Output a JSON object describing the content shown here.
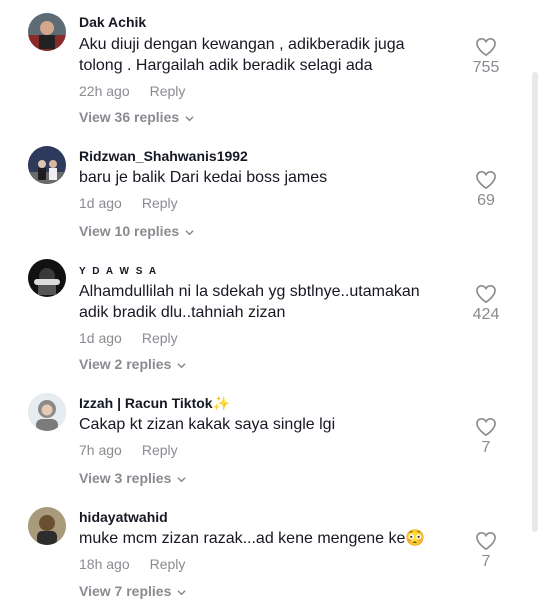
{
  "comments": [
    {
      "username": "Dak Achik",
      "text": "Aku diuji dengan kewangan , adikberadik juga tolong . Hargailah adik beradik selagi ada",
      "time": "22h ago",
      "reply_label": "Reply",
      "view_replies": "View 36 replies",
      "likes": "755",
      "avatar_color": "#7a2b2b"
    },
    {
      "username": "Ridzwan_Shahwanis1992",
      "text": "baru je balik Dari kedai boss james",
      "time": "1d ago",
      "reply_label": "Reply",
      "view_replies": "View 10 replies",
      "likes": "69",
      "avatar_color": "#3b4d7a"
    },
    {
      "username": "Y D A W S A",
      "text": "Alhamdullilah ni la sdekah yg sbtlnye..utamakan adik bradik dlu..tahniah zizan",
      "time": "1d ago",
      "reply_label": "Reply",
      "view_replies": "View 2 replies",
      "likes": "424",
      "avatar_color": "#1a1a1a"
    },
    {
      "username": "Izzah | Racun Tiktok✨",
      "text": "Cakap kt zizan kakak saya single lgi",
      "time": "7h ago",
      "reply_label": "Reply",
      "view_replies": "View 3 replies",
      "likes": "7",
      "avatar_color": "#cfd8dc"
    },
    {
      "username": "hidayatwahid",
      "text": "muke mcm zizan razak...ad kene mengene ke😳",
      "time": "18h ago",
      "reply_label": "Reply",
      "view_replies": "View 7 replies",
      "likes": "7",
      "avatar_color": "#5a4a2a"
    }
  ],
  "icons": {
    "like": "heart-outline-icon",
    "expand": "chevron-down-icon"
  },
  "colors": {
    "primary_text": "#161823",
    "secondary_text": "#8a8b91"
  }
}
